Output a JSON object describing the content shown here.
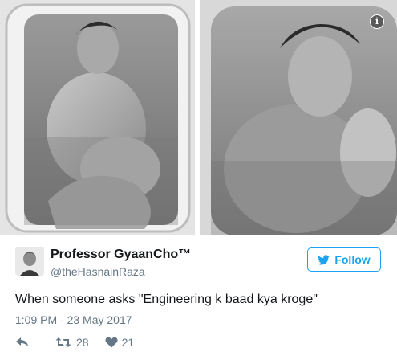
{
  "media": {
    "left_alt_icon": "photo-bathtub-left",
    "right_alt_icon": "photo-bathtub-right",
    "info_glyph": "i"
  },
  "tweet": {
    "display_name": "Professor GyaanCho™",
    "handle": "@theHasnainRaza",
    "follow_label": "Follow",
    "text": "When someone asks \"Engineering k baad kya kroge\"",
    "timestamp": "1:09 PM - 23 May 2017",
    "retweets": "28",
    "likes": "21"
  },
  "icons": {
    "reply": "reply-icon",
    "retweet": "retweet-icon",
    "like": "heart-icon",
    "bird": "twitter-bird-icon",
    "info": "info-icon"
  },
  "colors": {
    "accent": "#1da1f2",
    "text": "#14171a",
    "muted": "#657786"
  }
}
